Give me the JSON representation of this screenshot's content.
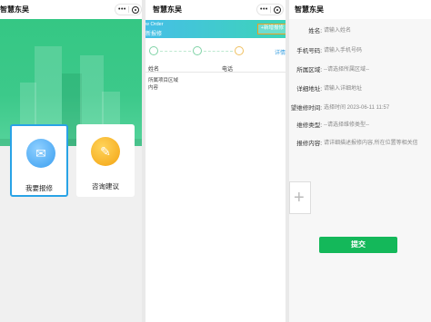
{
  "app_title": "智慧东吴",
  "panel1": {
    "card_repair_label": "我要报修",
    "card_advice_label": "咨询建议",
    "icons": {
      "repair": "envelope-icon",
      "advice": "document-icon"
    }
  },
  "panel2": {
    "bar_subtitle": "w Order",
    "bar_title": "新报修",
    "new_button": "+新增报修",
    "detail_link": "详情",
    "columns": [
      "姓名",
      "电话"
    ],
    "row_lines": [
      "所属项目区域",
      "内容"
    ]
  },
  "panel3": {
    "fields": [
      {
        "label": "姓名:",
        "value": "请输入姓名"
      },
      {
        "label": "手机号码:",
        "value": "请输入手机号码"
      },
      {
        "label": "所属区域:",
        "value": "--请选择所属区域--"
      },
      {
        "label": "详细地址:",
        "value": "请输入详细地址"
      },
      {
        "label": "望维修时间:",
        "value": "选择时间 2023-06-11 11:57"
      },
      {
        "label": "维修类型:",
        "value": "--请选择维修类型--"
      },
      {
        "label": "报修内容:",
        "value": "请详细描述报修内容,所在位置等相关信"
      }
    ],
    "submit_label": "提交"
  },
  "colors": {
    "green_hero": "#3cc98a",
    "blue_bar": "#45bfe6",
    "submit_green": "#14b85a",
    "highlight_blue": "#29a3e6",
    "highlight_orange": "#f0a020"
  }
}
